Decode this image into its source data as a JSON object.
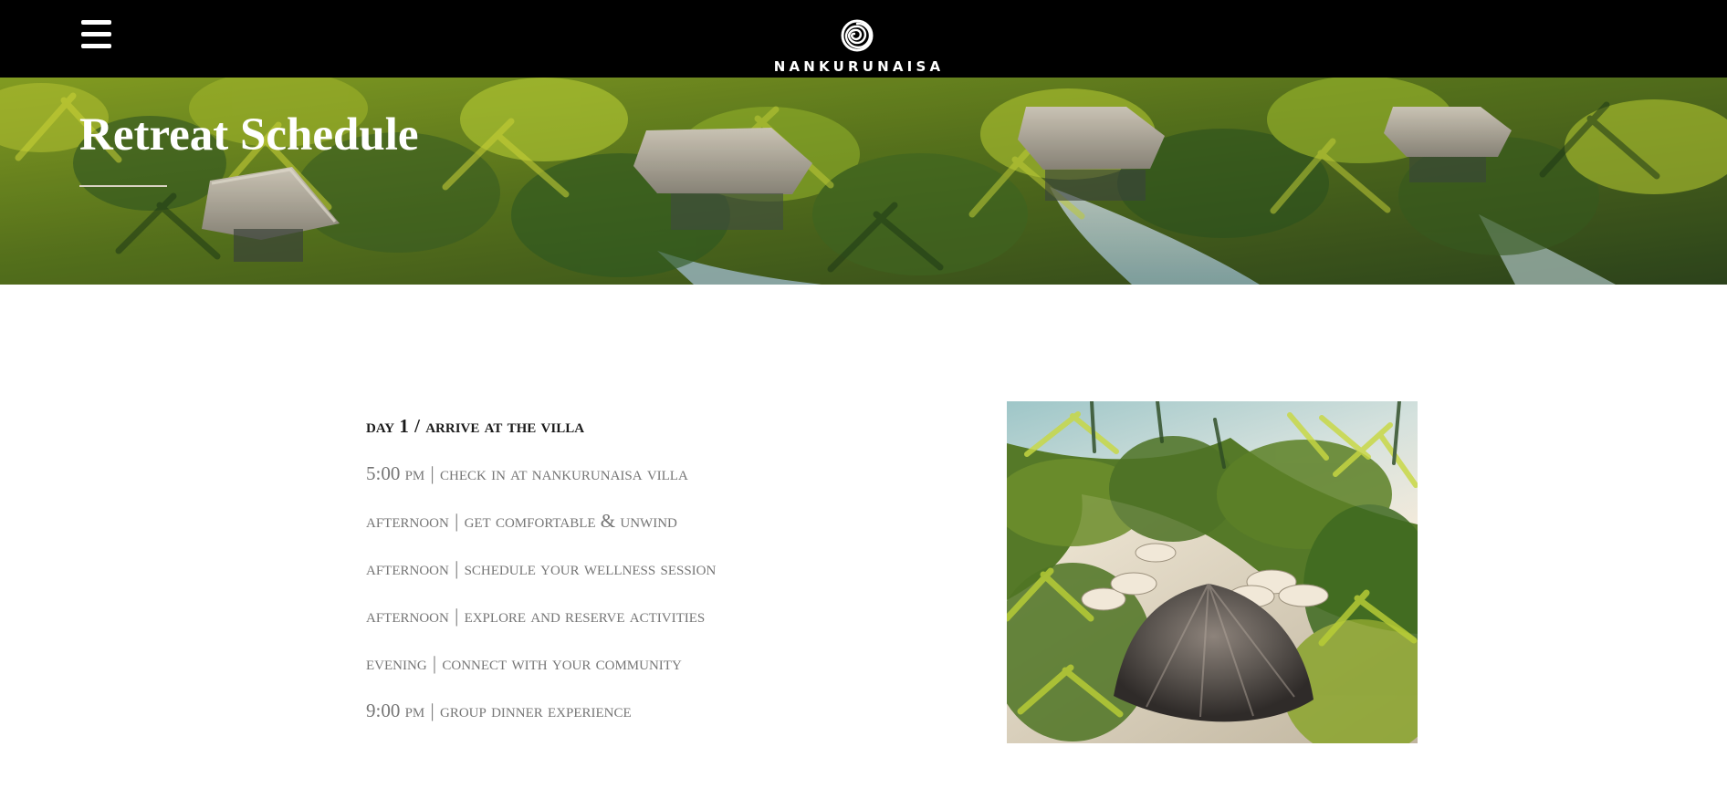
{
  "header": {
    "brand_name": "NANKURUNAISA",
    "menu_icon": "hamburger-menu-icon",
    "logo_icon": "spiral-logo-icon",
    "background_color": "#000000"
  },
  "hero": {
    "title": "Retreat Schedule"
  },
  "schedule": {
    "day_label": "day",
    "day_number": "1",
    "day_separator": "/",
    "day_title": "arrive at the villa",
    "items": [
      {
        "time": "5:00 pm",
        "separator": "|",
        "activity": "check in at nankurunaisa villa"
      },
      {
        "time": "afternoon",
        "separator": "|",
        "activity": "get comfortable & unwind"
      },
      {
        "time": "afternoon",
        "separator": "|",
        "activity": "schedule your wellness session"
      },
      {
        "time": "afternoon",
        "separator": "|",
        "activity": "explore and reserve activities"
      },
      {
        "time": "evening",
        "separator": "|",
        "activity": "connect with your community"
      },
      {
        "time": "9:00 pm",
        "separator": "|",
        "activity": "group dinner experience"
      }
    ]
  },
  "colors": {
    "text_dark": "#1a1a1a",
    "text_muted": "#767676",
    "header_background": "#000000"
  }
}
